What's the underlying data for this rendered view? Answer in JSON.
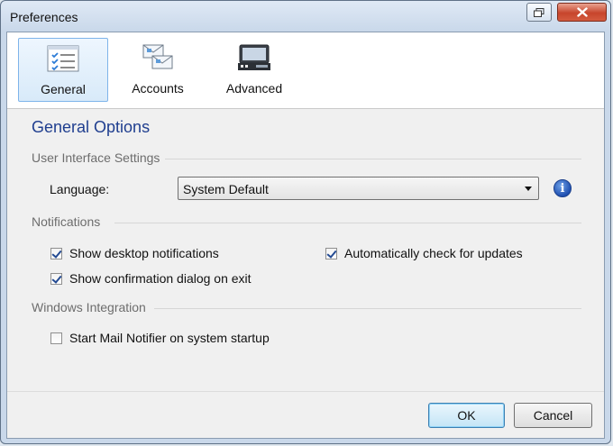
{
  "window": {
    "title": "Preferences"
  },
  "toolbar": {
    "items": [
      {
        "label": "General",
        "icon": "checklist-icon",
        "selected": true
      },
      {
        "label": "Accounts",
        "icon": "accounts-icon",
        "selected": false
      },
      {
        "label": "Advanced",
        "icon": "advanced-icon",
        "selected": false
      }
    ]
  },
  "main": {
    "heading": "General Options",
    "ui_settings": {
      "group_title": "User Interface Settings",
      "language_label": "Language:",
      "language_value": "System Default"
    },
    "notifications": {
      "group_title": "Notifications",
      "desktop": {
        "label": "Show desktop notifications",
        "checked": true
      },
      "confirm_exit": {
        "label": "Show confirmation dialog on exit",
        "checked": true
      },
      "auto_update": {
        "label": "Automatically check for updates",
        "checked": true
      }
    },
    "windows_integration": {
      "group_title": "Windows Integration",
      "startup": {
        "label": "Start Mail Notifier on system startup",
        "checked": false
      }
    }
  },
  "footer": {
    "ok_label": "OK",
    "cancel_label": "Cancel"
  },
  "colors": {
    "heading": "#1f3e8f",
    "selection": "#d8eaf9",
    "close_button": "#c7452c"
  }
}
